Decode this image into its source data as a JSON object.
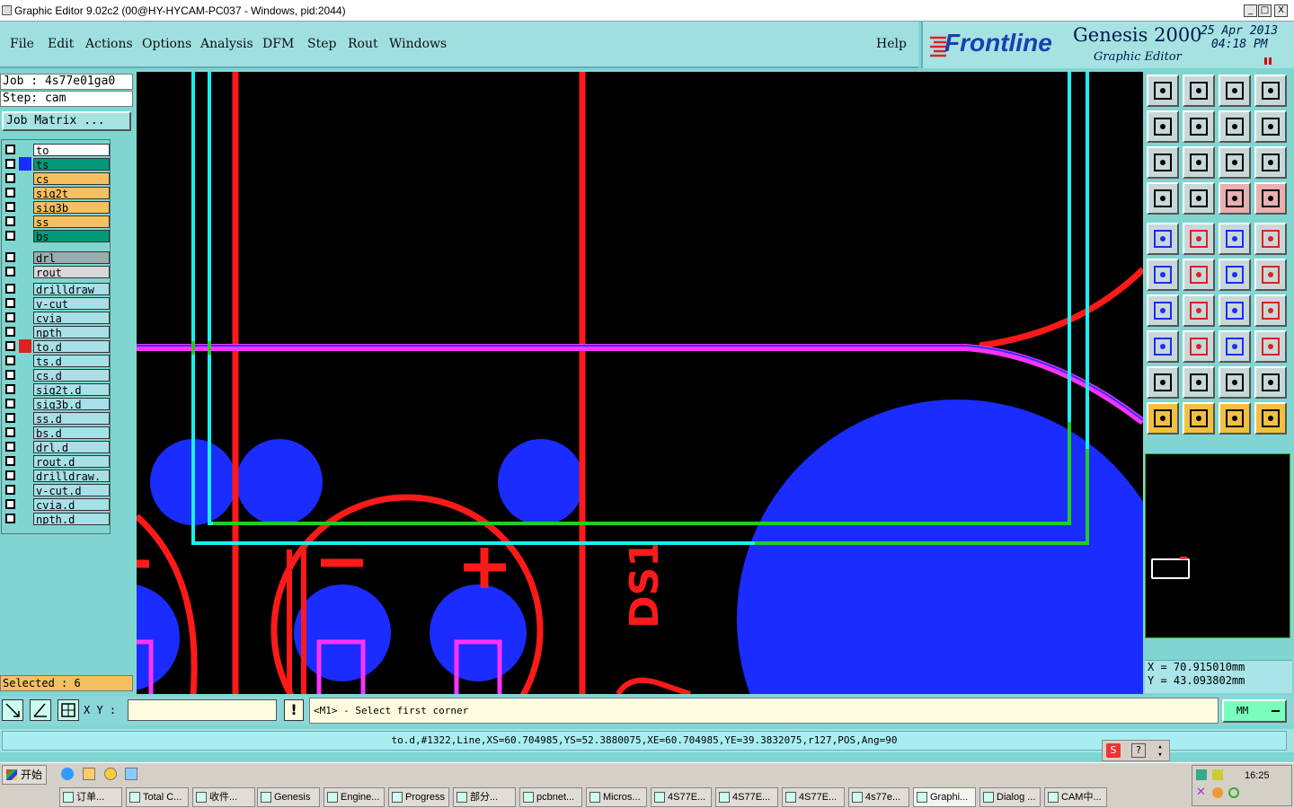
{
  "window": {
    "title": "Graphic Editor 9.02c2 (00@HY-HYCAM-PC037 - Windows, pid:2044)",
    "buttons": {
      "minimize": "_",
      "maximize": "□",
      "close": "X"
    }
  },
  "menu": {
    "items": [
      "File",
      "Edit",
      "Actions",
      "Options",
      "Analysis",
      "DFM",
      "Step",
      "Rout",
      "Windows"
    ],
    "help": "Help"
  },
  "brand": {
    "logo": "Frontline",
    "product": "Genesis 2000",
    "subtitle": "Graphic Editor",
    "date": "25 Apr 2013",
    "time": "04:18 PM"
  },
  "job": {
    "job_line": "Job : 4s77e01ga0",
    "step_line": "Step: cam",
    "matrix_button": "Job Matrix ..."
  },
  "layers": {
    "group1": [
      {
        "name": "to",
        "color": "#ffffff"
      },
      {
        "name": "ts",
        "color": "#009a78"
      },
      {
        "name": "cs",
        "color": "#f5c060"
      },
      {
        "name": "sig2t",
        "color": "#f5c060"
      },
      {
        "name": "sig3b",
        "color": "#f5c060"
      },
      {
        "name": "ss",
        "color": "#f5c060"
      },
      {
        "name": "bs",
        "color": "#009a78"
      }
    ],
    "group2": [
      {
        "name": "drl",
        "color": "#9aacb0"
      },
      {
        "name": "rout",
        "color": "#d8d8d8"
      }
    ],
    "group3": [
      {
        "name": "drilldraw",
        "color": "#a8e0e8"
      },
      {
        "name": "v-cut",
        "color": "#a8e0e8"
      },
      {
        "name": "cvia",
        "color": "#a8e0e8"
      },
      {
        "name": "npth",
        "color": "#a8e0e8"
      },
      {
        "name": "to.d",
        "color": "#a8e0e8"
      },
      {
        "name": "ts.d",
        "color": "#a8e0e8"
      },
      {
        "name": "cs.d",
        "color": "#a8e0e8"
      },
      {
        "name": "sig2t.d",
        "color": "#a8e0e8"
      },
      {
        "name": "sig3b.d",
        "color": "#a8e0e8"
      },
      {
        "name": "ss.d",
        "color": "#a8e0e8"
      },
      {
        "name": "bs.d",
        "color": "#a8e0e8"
      },
      {
        "name": "drl.d",
        "color": "#a8e0e8"
      },
      {
        "name": "rout.d",
        "color": "#a8e0e8"
      },
      {
        "name": "drilldraw.",
        "color": "#a8e0e8"
      },
      {
        "name": "v-cut.d",
        "color": "#a8e0e8"
      },
      {
        "name": "cvia.d",
        "color": "#a8e0e8"
      },
      {
        "name": "npth.d",
        "color": "#a8e0e8"
      }
    ]
  },
  "selected": "Selected : 6",
  "canvas": {
    "silkscreen_label": "DS1"
  },
  "coords": {
    "x": "X =  70.915010mm",
    "y": "Y =  43.093802mm"
  },
  "command": {
    "xy_label": "X Y :",
    "xy_value": "",
    "prompt": "<M1> - Select first corner",
    "units": "MM"
  },
  "status": {
    "feature": "to.d,#1322,Line,XS=60.704985,YS=52.3880075,XE=60.704985,YE=39.3832075,r127,POS,Ang=90"
  },
  "taskbar": {
    "start": "开始",
    "clock": "16:25",
    "tasks": [
      "订单...",
      "Total C...",
      "收件...",
      "Genesis",
      "Engine...",
      "Progress",
      "部分...",
      "pcbnet...",
      "Micros...",
      "4S77E...",
      "4S77E...",
      "4S77E...",
      "4s77e...",
      "Graphi...",
      "Dialog ...",
      "CAM中..."
    ]
  },
  "colors": {
    "red": "#ff1a1a",
    "cyan": "#19f0f0",
    "magenta": "#ff33ff",
    "blue": "#1a2cff",
    "green": "#22cc22"
  }
}
